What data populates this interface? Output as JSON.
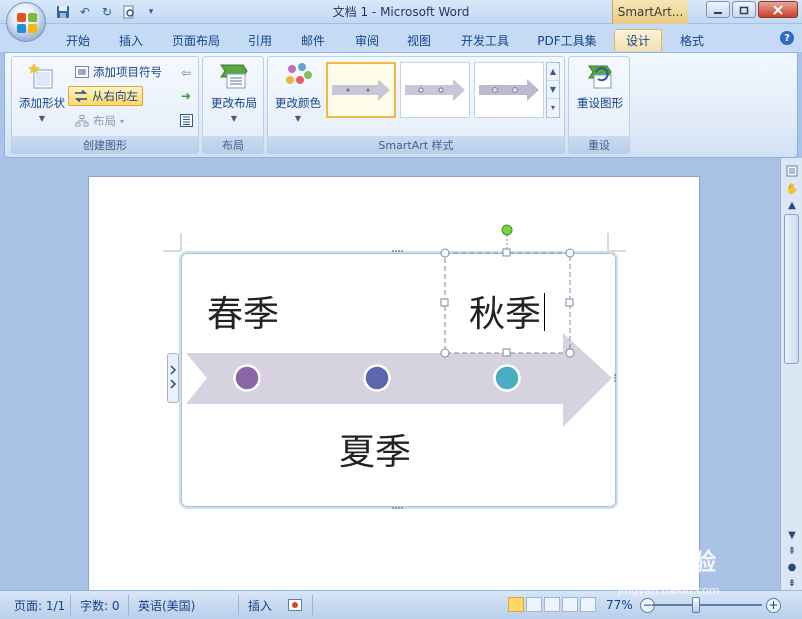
{
  "window": {
    "title": "文档 1 - Microsoft Word",
    "contextual_tab": "SmartArt..."
  },
  "tabs": [
    "开始",
    "插入",
    "页面布局",
    "引用",
    "邮件",
    "审阅",
    "视图",
    "开发工具",
    "PDF工具集",
    "设计",
    "格式"
  ],
  "active_tab": "设计",
  "ribbon": {
    "create_graphic": {
      "label": "创建图形",
      "add_shape": "添加形状",
      "add_bullet": "添加项目符号",
      "right_to_left": "从右向左",
      "layout": "布局"
    },
    "layouts": {
      "label": "布局",
      "change_layout": "更改布局"
    },
    "styles": {
      "label": "SmartArt 样式",
      "change_colors": "更改颜色"
    },
    "reset": {
      "label": "重设",
      "reset_graphic": "重设图形"
    }
  },
  "smartart": {
    "items": [
      "春季",
      "夏季",
      "秋季"
    ],
    "dot_colors": [
      "#8a66a9",
      "#5b66ac",
      "#4aaec3"
    ],
    "arrow_color": "#d6d2e0"
  },
  "status": {
    "page": "页面: 1/1",
    "words": "字数: 0",
    "language": "英语(美国)",
    "mode": "插入",
    "zoom": "77%"
  },
  "watermark": {
    "main": "Bai 经验",
    "sub": "jingyan.baidu.com"
  }
}
